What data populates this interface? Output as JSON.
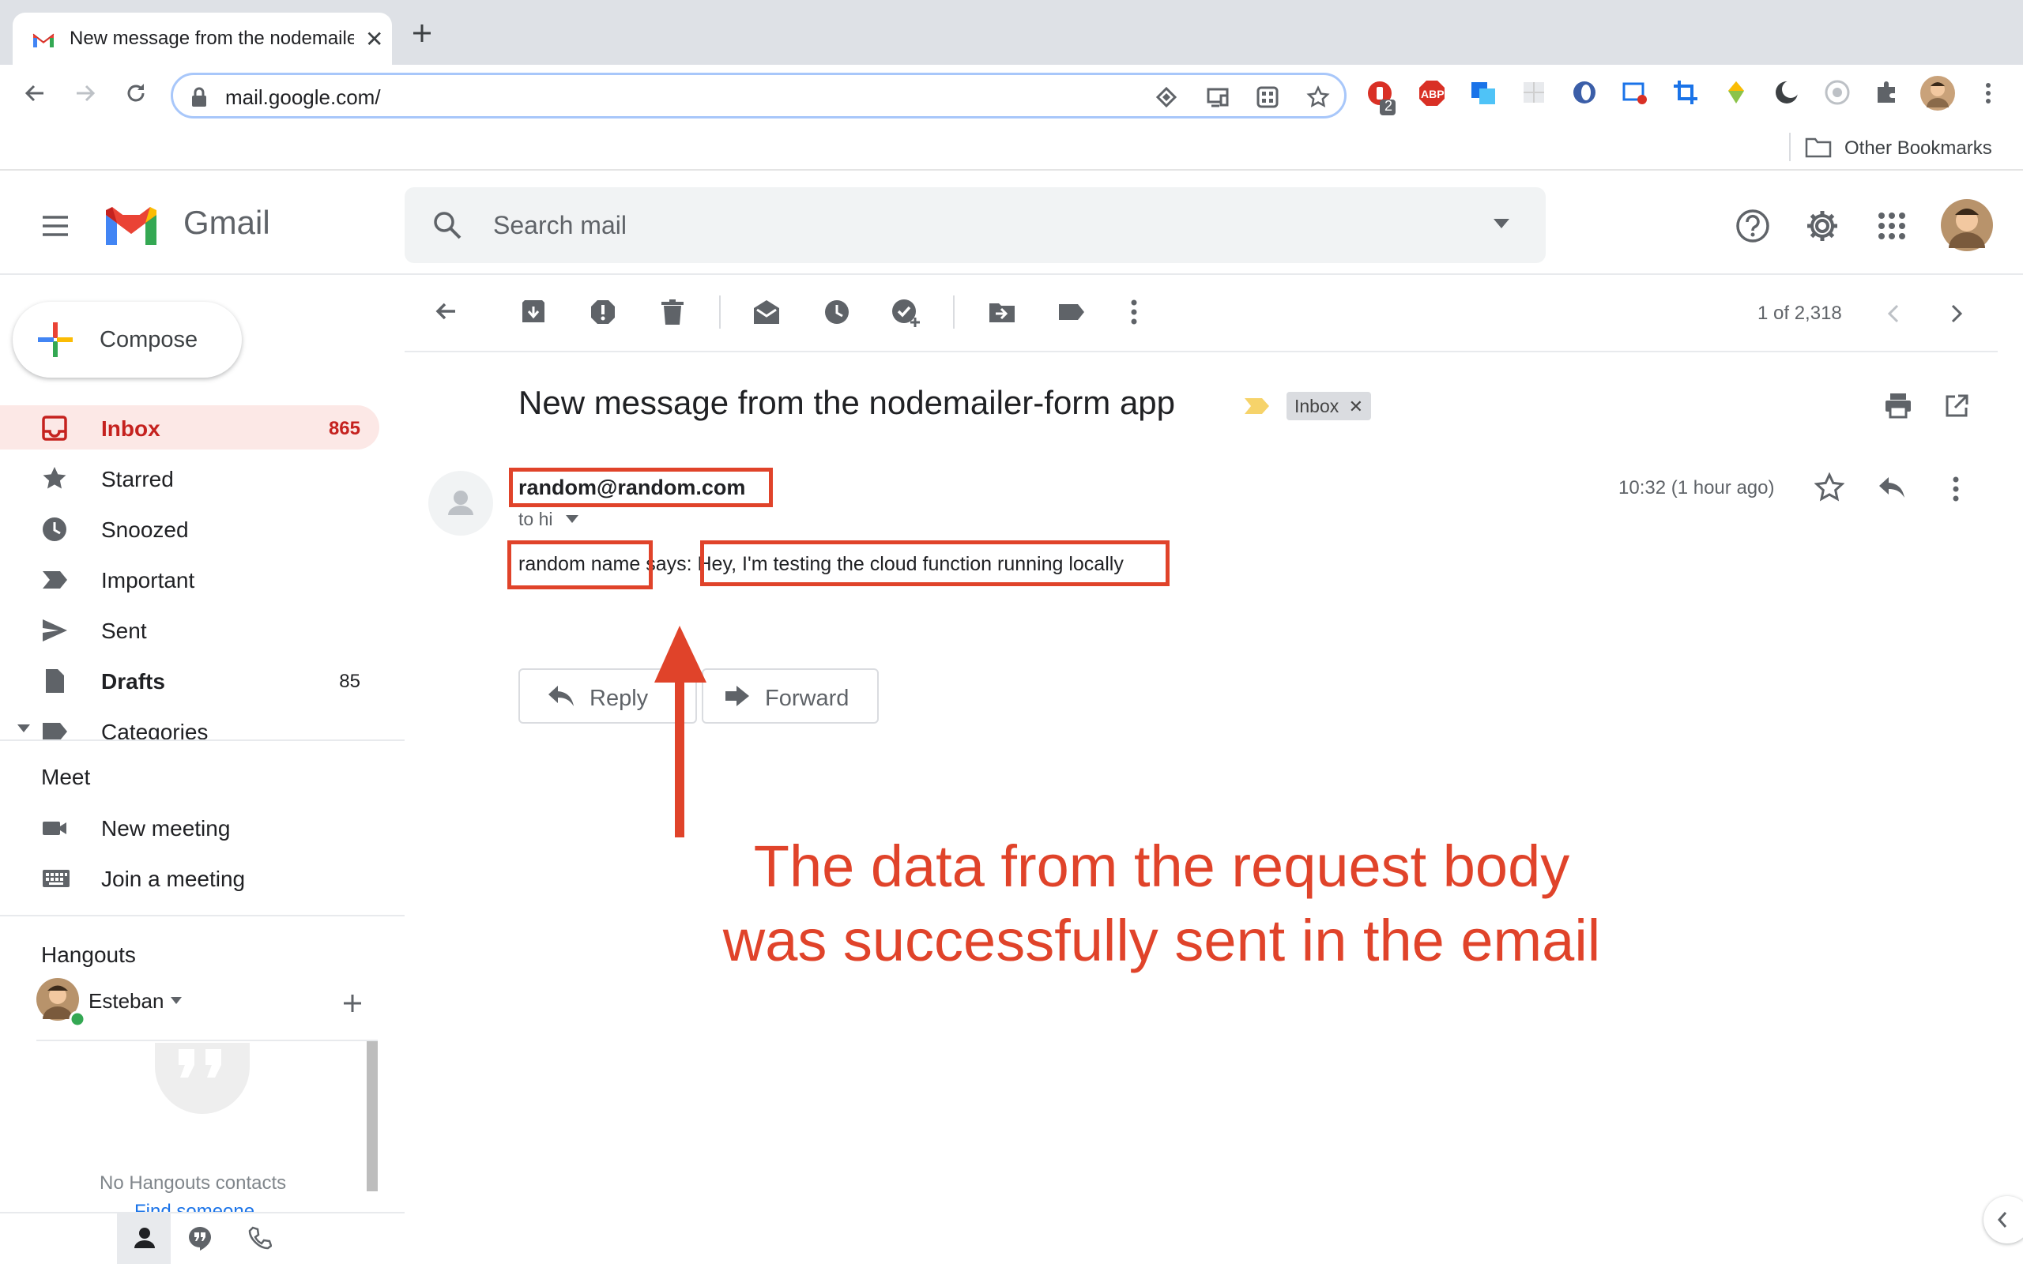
{
  "browser": {
    "tab_title": "New message from the nodemailer-form app",
    "url": "mail.google.com/",
    "bookmarks": {
      "other": "Other Bookmarks"
    },
    "extension_badge": "2",
    "abp_label": "ABP"
  },
  "gmail": {
    "brand": "Gmail",
    "search_placeholder": "Search mail",
    "compose_label": "Compose",
    "nav": [
      {
        "label": "Inbox",
        "count": "865"
      },
      {
        "label": "Starred",
        "count": ""
      },
      {
        "label": "Snoozed",
        "count": ""
      },
      {
        "label": "Important",
        "count": ""
      },
      {
        "label": "Sent",
        "count": ""
      },
      {
        "label": "Drafts",
        "count": "85"
      },
      {
        "label": "Categories",
        "count": ""
      }
    ],
    "meet": {
      "title": "Meet",
      "new_meeting": "New meeting",
      "join_meeting": "Join a meeting"
    },
    "hangouts": {
      "title": "Hangouts",
      "user": "Esteban",
      "empty": "No Hangouts contacts",
      "find": "Find someone"
    }
  },
  "message": {
    "pager": "1 of 2,318",
    "subject": "New message from the nodemailer-form app",
    "label_chip": "Inbox",
    "sender": "random@random.com",
    "to": "to hi",
    "time": "10:32 (1 hour ago)",
    "body_name": "random name",
    "body_says": " says: ",
    "body_text": "Hey, I'm testing the cloud function running locally",
    "reply_label": "Reply",
    "forward_label": "Forward"
  },
  "annotation": {
    "line1": "The data from the request body",
    "line2": "was successfully sent in the email"
  },
  "colors": {
    "annotation_red": "#e0432a",
    "inbox_red": "#c5221f",
    "gmail_blue": "#4285f4",
    "gmail_red": "#ea4335",
    "gmail_yellow": "#fbbc04",
    "gmail_green": "#34a853"
  }
}
